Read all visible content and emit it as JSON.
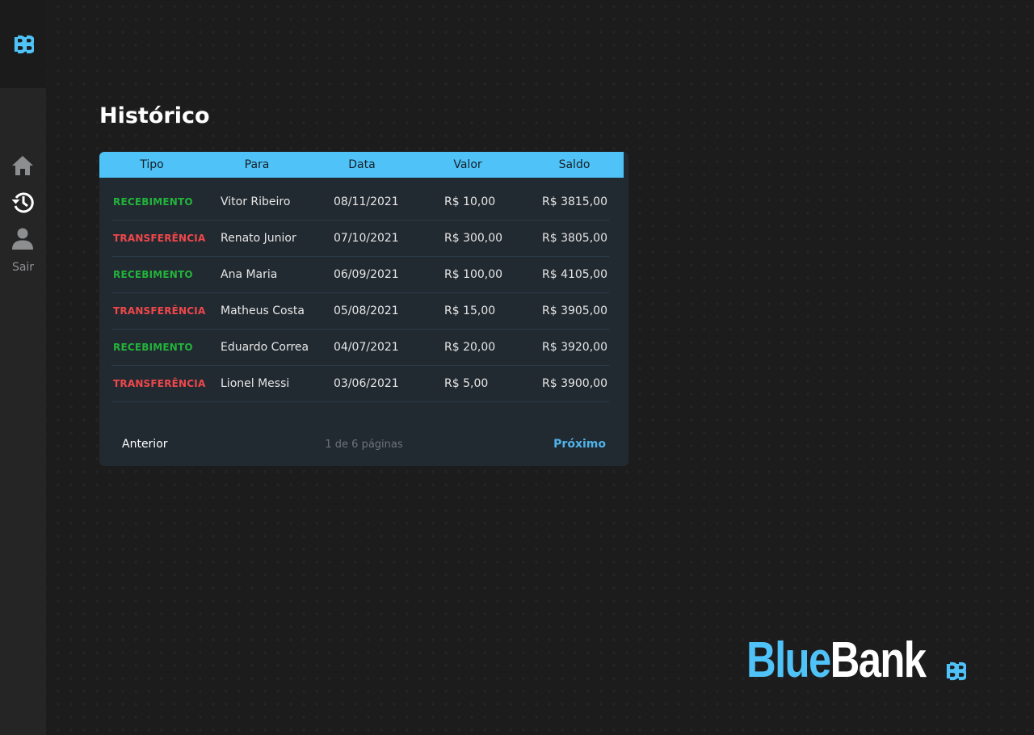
{
  "colors": {
    "accent": "#4fc3f7",
    "recebimento": "#22b33a",
    "transferencia": "#f0474b",
    "background": "#1c1c1d",
    "card": "#222a31"
  },
  "sidebar": {
    "logo_icon": "bluebank-logo-icon",
    "items": [
      {
        "icon": "home-icon"
      },
      {
        "icon": "history-icon"
      },
      {
        "icon": "user-icon"
      }
    ],
    "logout_label": "Sair"
  },
  "page": {
    "title": "Histórico"
  },
  "table": {
    "columns": [
      "Tipo",
      "Para",
      "Data",
      "Valor",
      "Saldo"
    ],
    "rows": [
      {
        "tipo": "RECEBIMENTO",
        "para": "Vitor Ribeiro",
        "data": "08/11/2021",
        "valor": "R$ 10,00",
        "saldo": "R$ 3815,00"
      },
      {
        "tipo": "TRANSFERÊNCIA",
        "para": "Renato Junior",
        "data": "07/10/2021",
        "valor": "R$ 300,00",
        "saldo": "R$ 3805,00"
      },
      {
        "tipo": "RECEBIMENTO",
        "para": "Ana Maria",
        "data": "06/09/2021",
        "valor": "R$ 100,00",
        "saldo": "R$ 4105,00"
      },
      {
        "tipo": "TRANSFERÊNCIA",
        "para": "Matheus Costa",
        "data": "05/08/2021",
        "valor": "R$ 15,00",
        "saldo": "R$ 3905,00"
      },
      {
        "tipo": "RECEBIMENTO",
        "para": "Eduardo Correa",
        "data": "04/07/2021",
        "valor": "R$ 20,00",
        "saldo": "R$ 3920,00"
      },
      {
        "tipo": "TRANSFERÊNCIA",
        "para": "Lionel Messi",
        "data": "03/06/2021",
        "valor": "R$ 5,00",
        "saldo": "R$ 3900,00"
      }
    ]
  },
  "pagination": {
    "prev_label": "Anterior",
    "status": "1 de 6 páginas",
    "next_label": "Próximo"
  },
  "brand": {
    "part1": "Blue",
    "part2": "Bank",
    "mark_icon": "bluebank-logo-icon"
  }
}
